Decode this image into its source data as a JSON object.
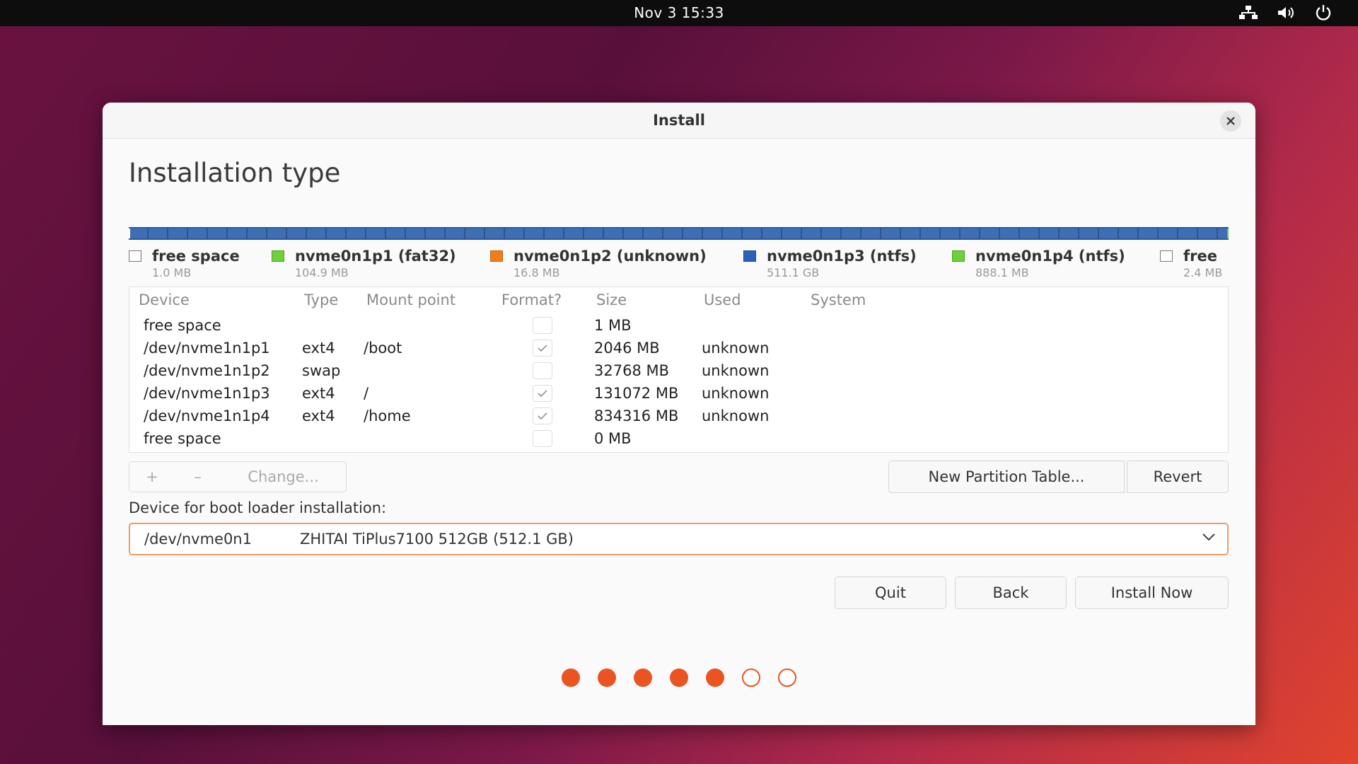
{
  "topbar": {
    "clock": "Nov 3  15:33",
    "icons": [
      "network-icon",
      "volume-icon",
      "power-icon"
    ]
  },
  "window": {
    "title": "Install"
  },
  "page": {
    "title": "Installation type"
  },
  "colors": {
    "accent": "#e95420",
    "ntfs_blue": "#2a62b8",
    "fat32_green": "#6ed03a",
    "unknown_orange": "#f07d1c"
  },
  "legend": [
    {
      "label": "free space",
      "size": "1.0 MB",
      "color": "#ffffff"
    },
    {
      "label": "nvme0n1p1 (fat32)",
      "size": "104.9 MB",
      "color": "#6ed03a"
    },
    {
      "label": "nvme0n1p2 (unknown)",
      "size": "16.8 MB",
      "color": "#f07d1c"
    },
    {
      "label": "nvme0n1p3 (ntfs)",
      "size": "511.1 GB",
      "color": "#2a62b8"
    },
    {
      "label": "nvme0n1p4 (ntfs)",
      "size": "888.1 MB",
      "color": "#6ed03a"
    },
    {
      "label": "free",
      "size": "2.4 MB",
      "color": "#ffffff"
    }
  ],
  "table": {
    "headers": {
      "device": "Device",
      "type": "Type",
      "mount": "Mount point",
      "format": "Format?",
      "size": "Size",
      "used": "Used",
      "system": "System"
    },
    "rows": [
      {
        "device": "free space",
        "type": "",
        "mount": "",
        "format": false,
        "size": "1 MB",
        "used": ""
      },
      {
        "device": "/dev/nvme1n1p1",
        "type": "ext4",
        "mount": "/boot",
        "format": true,
        "size": "2046 MB",
        "used": "unknown"
      },
      {
        "device": "/dev/nvme1n1p2",
        "type": "swap",
        "mount": "",
        "format": false,
        "size": "32768 MB",
        "used": "unknown"
      },
      {
        "device": "/dev/nvme1n1p3",
        "type": "ext4",
        "mount": "/",
        "format": true,
        "size": "131072 MB",
        "used": "unknown"
      },
      {
        "device": "/dev/nvme1n1p4",
        "type": "ext4",
        "mount": "/home",
        "format": true,
        "size": "834316 MB",
        "used": "unknown"
      },
      {
        "device": "free space",
        "type": "",
        "mount": "",
        "format": false,
        "size": "0 MB",
        "used": ""
      }
    ]
  },
  "toolbar": {
    "add": "+",
    "remove": "–",
    "change": "Change...",
    "new_table": "New Partition Table...",
    "revert": "Revert"
  },
  "bootloader": {
    "label": "Device for boot loader installation:",
    "device": "/dev/nvme0n1",
    "name": "ZHITAI TiPlus7100 512GB (512.1 GB)"
  },
  "buttons": {
    "quit": "Quit",
    "back": "Back",
    "install": "Install Now"
  },
  "progress": {
    "steps_total": 7,
    "steps_done": 5
  }
}
